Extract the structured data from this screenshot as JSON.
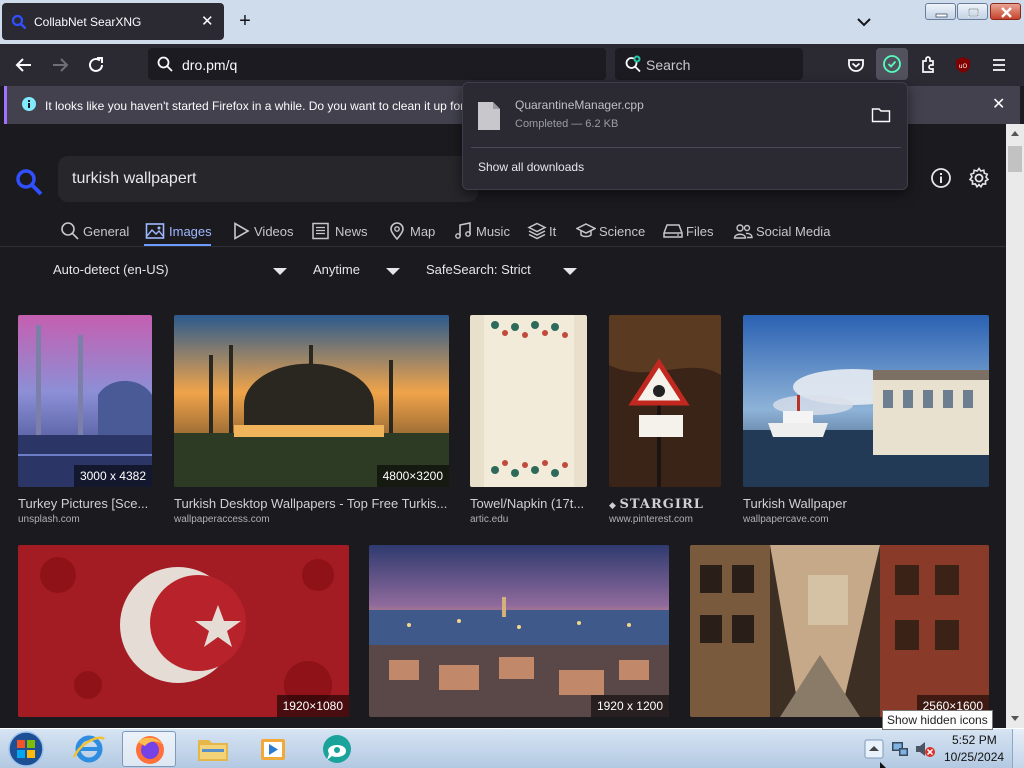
{
  "browser": {
    "tab_title": "CollabNet SearXNG",
    "url": "dro.pm/q",
    "search_placeholder": "Search"
  },
  "notification": {
    "text": "It looks like you haven't started Firefox in a while. Do you want to clean it up for"
  },
  "downloads": {
    "file_name": "QuarantineManager.cpp",
    "status": "Completed — 6.2 KB",
    "show_all": "Show all downloads"
  },
  "search": {
    "query": "turkish wallpapert"
  },
  "categories": [
    {
      "label": "General",
      "icon": "search-icon"
    },
    {
      "label": "Images",
      "icon": "image-icon",
      "active": true
    },
    {
      "label": "Videos",
      "icon": "play-icon"
    },
    {
      "label": "News",
      "icon": "newspaper-icon"
    },
    {
      "label": "Map",
      "icon": "map-pin-icon"
    },
    {
      "label": "Music",
      "icon": "music-icon"
    },
    {
      "label": "It",
      "icon": "layers-icon"
    },
    {
      "label": "Science",
      "icon": "graduation-cap-icon"
    },
    {
      "label": "Files",
      "icon": "drive-icon"
    },
    {
      "label": "Social Media",
      "icon": "people-icon"
    }
  ],
  "filters": {
    "language": "Auto-detect (en-US)",
    "time": "Anytime",
    "safesearch": "SafeSearch: Strict"
  },
  "results": [
    {
      "title": "Turkey Pictures [Sce...",
      "source": "unsplash.com",
      "size": "3000 x 4382"
    },
    {
      "title": "Turkish Desktop Wallpapers - Top Free Turkis...",
      "source": "wallpaperaccess.com",
      "size": "4800×3200"
    },
    {
      "title": "Towel/Napkin (17t...",
      "source": "artic.edu",
      "size": ""
    },
    {
      "title": "STARGIRL",
      "source": "www.pinterest.com",
      "size": ""
    },
    {
      "title": "Turkish Wallpaper",
      "source": "wallpapercave.com",
      "size": ""
    },
    {
      "title": "",
      "source": "",
      "size": "1920×1080"
    },
    {
      "title": "",
      "source": "",
      "size": "1920 x 1200"
    },
    {
      "title": "",
      "source": "",
      "size": "2560×1600"
    }
  ],
  "taskbar": {
    "time": "5:52 PM",
    "date": "10/25/2024",
    "tooltip": "Show hidden icons"
  },
  "colors": {
    "accent": "#6f9bff",
    "page_bg": "#1b1b1f",
    "toolbar_bg": "#2b2a33"
  }
}
